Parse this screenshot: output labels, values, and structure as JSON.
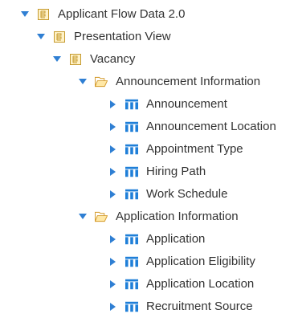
{
  "tree": {
    "root": {
      "label": "Applicant Flow Data 2.0",
      "icon": "package-icon",
      "expanded": true
    },
    "view": {
      "label": "Presentation View",
      "icon": "package-icon",
      "expanded": true
    },
    "vacancy": {
      "label": "Vacancy",
      "icon": "package-icon",
      "expanded": true
    },
    "folders": [
      {
        "label": "Announcement Information",
        "icon": "folder-open-icon",
        "expanded": true,
        "tables": [
          {
            "label": "Announcement",
            "icon": "table-icon"
          },
          {
            "label": "Announcement Location",
            "icon": "table-icon"
          },
          {
            "label": "Appointment Type",
            "icon": "table-icon"
          },
          {
            "label": "Hiring Path",
            "icon": "table-icon"
          },
          {
            "label": "Work Schedule",
            "icon": "table-icon"
          }
        ]
      },
      {
        "label": "Application Information",
        "icon": "folder-open-icon",
        "expanded": true,
        "tables": [
          {
            "label": "Application",
            "icon": "table-icon"
          },
          {
            "label": "Application Eligibility",
            "icon": "table-icon"
          },
          {
            "label": "Application Location",
            "icon": "table-icon"
          },
          {
            "label": "Recruitment Source",
            "icon": "table-icon"
          }
        ]
      }
    ]
  },
  "colors": {
    "twisty": "#2f7fd3",
    "package_outline": "#c59a2e",
    "folder_outline": "#d49a2a",
    "table_blue": "#1f7fd8",
    "text": "#333333"
  }
}
